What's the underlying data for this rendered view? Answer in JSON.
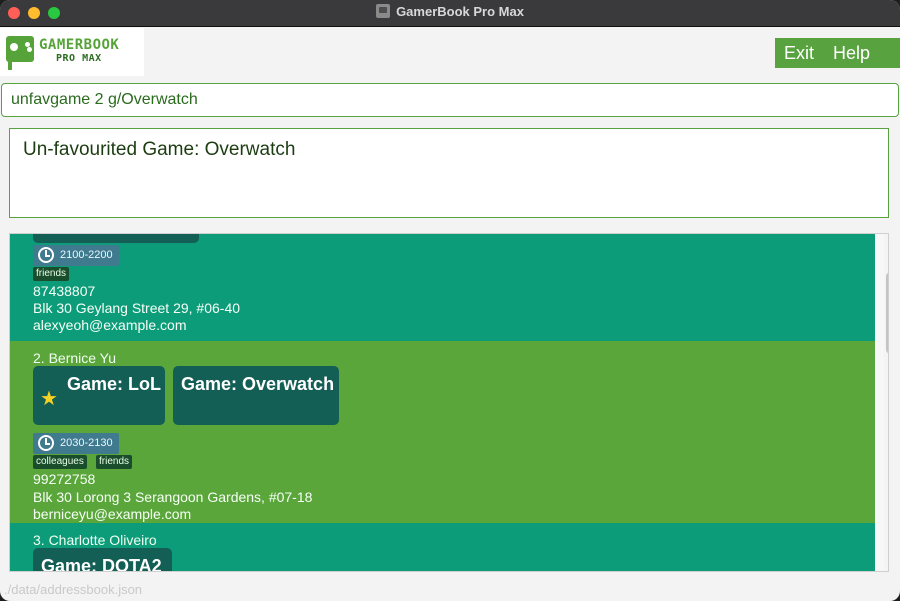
{
  "window": {
    "title": "GamerBook Pro Max"
  },
  "logo": {
    "title": "GAMERBOOK",
    "subtitle": "PRO MAX"
  },
  "menu": {
    "exit": "Exit",
    "help": "Help"
  },
  "command_box": {
    "value": "unfavgame 2 g/Overwatch"
  },
  "result_display": {
    "text": "Un-favourited Game: Overwatch"
  },
  "persons": [
    {
      "time": "2100-2200",
      "tags": [
        "friends"
      ],
      "phone": "87438807",
      "address": "Blk 30 Geylang Street 29, #06-40",
      "email": "alexyeoh@example.com"
    },
    {
      "name": "2. Bernice Yu",
      "games": [
        {
          "label": "Game: LoL",
          "favourite": true
        },
        {
          "label": "Game: Overwatch",
          "favourite": false
        }
      ],
      "time": "2030-2130",
      "tags": [
        "colleagues",
        "friends"
      ],
      "phone": "99272758",
      "address": "Blk 30 Lorong 3 Serangoon Gardens, #07-18",
      "email": "berniceyu@example.com"
    },
    {
      "name": "3. Charlotte Oliveiro",
      "games": [
        {
          "label": "Game: DOTA2",
          "favourite": false
        }
      ]
    }
  ],
  "status_bar": {
    "path": "./data/addressbook.json"
  },
  "colors": {
    "accent_green": "#58a33f",
    "card_teal": "#0d9c7a",
    "card_green": "#5aa63b",
    "game_box": "#135e55"
  },
  "icons": {
    "favourite": "star-icon",
    "time": "clock-icon"
  }
}
